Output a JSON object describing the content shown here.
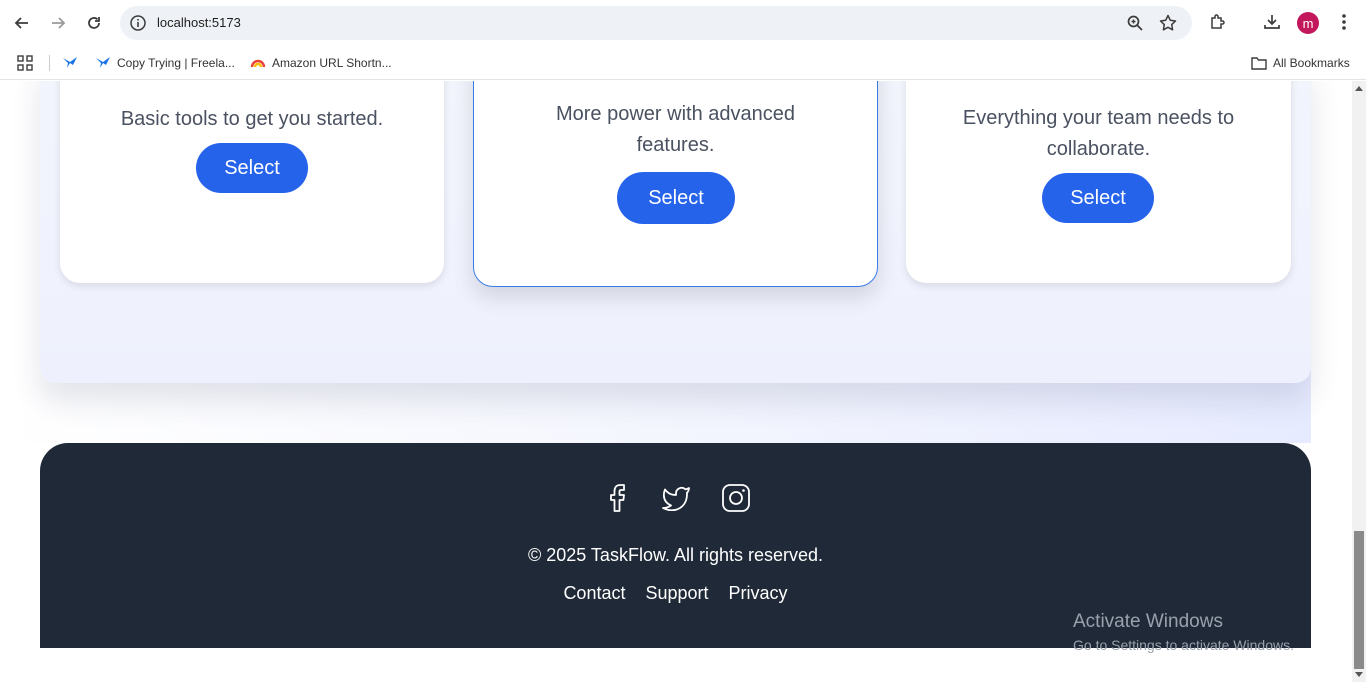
{
  "browser": {
    "url": "localhost:5173",
    "avatar_initial": "m",
    "bookmarks": [
      {
        "label": "Copy Trying | Freela..."
      },
      {
        "label": "Amazon URL Shortn..."
      }
    ],
    "all_bookmarks_label": "All Bookmarks"
  },
  "pricing": {
    "cards": [
      {
        "description": "Basic tools to get you started.",
        "button": "Select"
      },
      {
        "description": "More power with advanced features.",
        "button": "Select"
      },
      {
        "description": "Everything your team needs to collaborate.",
        "button": "Select"
      }
    ]
  },
  "footer": {
    "social_icons": [
      "facebook-icon",
      "twitter-icon",
      "instagram-icon"
    ],
    "copyright": "© 2025 TaskFlow. All rights reserved.",
    "links": [
      "Contact",
      "Support",
      "Privacy"
    ]
  },
  "watermark": {
    "title": "Activate Windows",
    "subtitle": "Go to Settings to activate Windows."
  },
  "colors": {
    "accent": "#2563eb",
    "footer_bg": "#1f2937",
    "avatar": "#c2185b"
  }
}
